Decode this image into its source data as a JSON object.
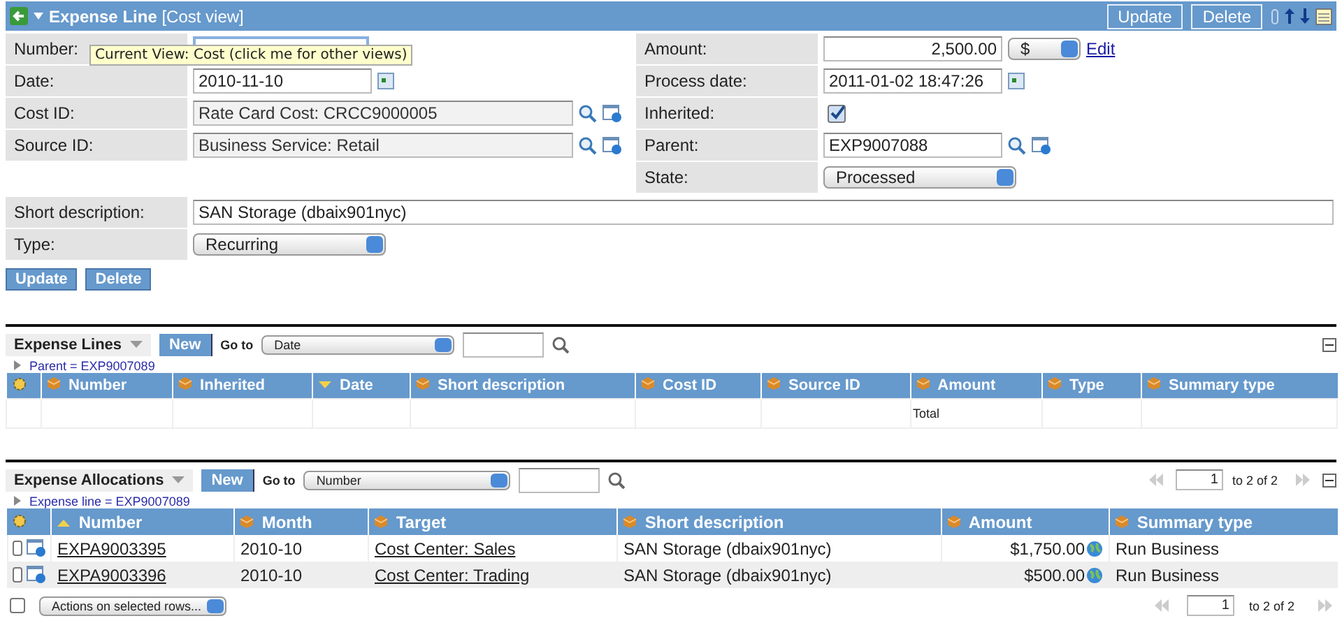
{
  "header": {
    "title": "**Expense Line** [Cost view]",
    "buttons": [
      "Update",
      "Delete"
    ]
  },
  "tooltip": "Current View: Cost (click me for other views)",
  "left_fields": [
    {
      "kind": "hidden",
      "label": "Number:"
    },
    {
      "kind": "date",
      "label": "Date:",
      "value": "2010-11-10"
    },
    {
      "kind": "lookup",
      "label": "Cost ID:",
      "value": "Rate Card Cost: CRCC9000005"
    },
    {
      "kind": "lookup",
      "label": "Source ID:",
      "value": "Business Service: Retail"
    }
  ],
  "right_fields": [
    {
      "kind": "amount",
      "label": "Amount:",
      "value": "2,500.00",
      "currency": "$",
      "link": "Edit"
    },
    {
      "kind": "date",
      "label": "Process date:",
      "value": "2011-01-02 18:47:26"
    },
    {
      "kind": "checkbox",
      "label": "Inherited:",
      "checked": true
    },
    {
      "kind": "lookup",
      "label": "Parent:",
      "value": "EXP9007088"
    },
    {
      "kind": "select",
      "label": "State:",
      "value": "Processed"
    }
  ],
  "wide_fields": [
    {
      "kind": "text",
      "label": "Short description:",
      "value": "SAN Storage (dbaix901nyc)"
    },
    {
      "kind": "select",
      "label": "Type:",
      "value": "Recurring"
    }
  ],
  "form_buttons": [
    "Update",
    "Delete"
  ],
  "expense_lines": {
    "title": "Expense Lines",
    "new_button": "New",
    "goto_label": "Go to",
    "goto_value": "Date",
    "filter": "Parent = EXP9007089",
    "columns": [
      {
        "label": "Number",
        "kind": "plain"
      },
      {
        "label": "Inherited",
        "kind": "plain"
      },
      {
        "label": "Date",
        "kind": "descending"
      },
      {
        "label": "Short description",
        "kind": "plain"
      },
      {
        "label": "Cost ID",
        "kind": "plain"
      },
      {
        "label": "Source ID",
        "kind": "plain"
      },
      {
        "label": "Amount",
        "kind": "plain"
      },
      {
        "label": "Type",
        "kind": "plain"
      },
      {
        "label": "Summary type",
        "kind": "plain"
      }
    ],
    "total_label": "Total"
  },
  "expense_allocations": {
    "title": "Expense Allocations",
    "new_button": "New",
    "goto_label": "Go to",
    "goto_value": "Number",
    "filter": "Expense line = EXP9007089",
    "pager_top": {
      "page": "1",
      "range": "to 2 of 2"
    },
    "columns": [
      {
        "label": "Number",
        "kind": "ascending"
      },
      {
        "label": "Month",
        "kind": "plain"
      },
      {
        "label": "Target",
        "kind": "plain"
      },
      {
        "label": "Short description",
        "kind": "plain"
      },
      {
        "label": "Amount",
        "kind": "plain"
      },
      {
        "label": "Summary type",
        "kind": "plain"
      }
    ],
    "rows": [
      {
        "checked": false,
        "number": "EXPA9003395",
        "month": "2010-10",
        "target": "Cost Center: Sales",
        "short_description": "SAN Storage (dbaix901nyc)",
        "amount": "$1,750.00",
        "summary_type": "Run Business"
      },
      {
        "checked": false,
        "number": "EXPA9003396",
        "month": "2010-10",
        "target": "Cost Center: Trading",
        "short_description": "SAN Storage (dbaix901nyc)",
        "amount": "$500.00",
        "summary_type": "Run Business"
      }
    ],
    "select_all_checked": false,
    "actions_value": "Actions on selected rows...",
    "pager_bottom": {
      "page": "1",
      "range": "to 2 of 2"
    }
  }
}
